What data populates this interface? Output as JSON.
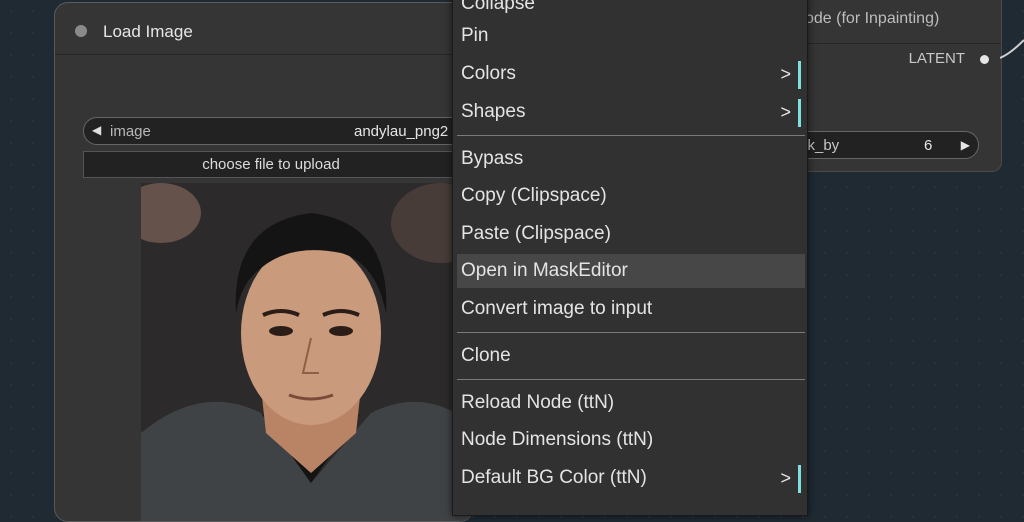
{
  "load_image_node": {
    "title": "Load Image",
    "image_widget": {
      "label": "image",
      "value": "andylau_png2"
    },
    "upload_button_label": "choose file to upload"
  },
  "right_node": {
    "title_partial": "ode (for Inpainting)",
    "output_label": "LATENT",
    "number_widget": {
      "label": "sk_by",
      "value": "6"
    }
  },
  "context_menu": {
    "items": [
      {
        "label": "Collapse",
        "submenu": false
      },
      {
        "label": "Pin",
        "submenu": false
      },
      {
        "label": "Colors",
        "submenu": true
      },
      {
        "label": "Shapes",
        "submenu": true
      },
      {
        "label": "Bypass",
        "submenu": false
      },
      {
        "label": "Copy (Clipspace)",
        "submenu": false
      },
      {
        "label": "Paste (Clipspace)",
        "submenu": false
      },
      {
        "label": "Open in MaskEditor",
        "submenu": false,
        "highlighted": true
      },
      {
        "label": "Convert image to input",
        "submenu": false
      },
      {
        "label": "Clone",
        "submenu": false
      },
      {
        "label": "Reload Node (ttN)",
        "submenu": false
      },
      {
        "label": "Node Dimensions (ttN)",
        "submenu": false
      },
      {
        "label": "Default BG Color (ttN)",
        "submenu": true
      }
    ],
    "submenu_arrow": ">"
  },
  "colors": {
    "canvas_bg": "#1f2a33",
    "node_bg": "#353535",
    "menu_bg": "#313131",
    "menu_highlight": "#474747",
    "submenu_accent": "#7fe0e0"
  }
}
